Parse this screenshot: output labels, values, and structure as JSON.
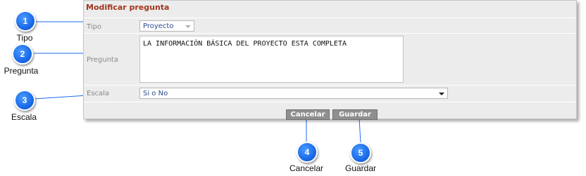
{
  "dialog": {
    "title": "Modificar pregunta",
    "tipo": {
      "label": "Tipo",
      "value": "Proyecto"
    },
    "pregunta": {
      "label": "Pregunta",
      "value": "LA INFORMACIÓN BÁSICA DEL PROYECTO ESTA COMPLETA"
    },
    "escala": {
      "label": "Escala",
      "value": "Si o No"
    },
    "cancel_label": "Cancelar",
    "save_label": "Guardar"
  },
  "callouts": [
    {
      "number": "1",
      "caption": "Tipo"
    },
    {
      "number": "2",
      "caption": "Pregunta"
    },
    {
      "number": "3",
      "caption": "Escala"
    },
    {
      "number": "4",
      "caption": "Cancelar"
    },
    {
      "number": "5",
      "caption": "Guardar"
    }
  ],
  "colors": {
    "title": "#a0361c",
    "callout": "#1b6be8",
    "button": "#8f8f8f"
  }
}
